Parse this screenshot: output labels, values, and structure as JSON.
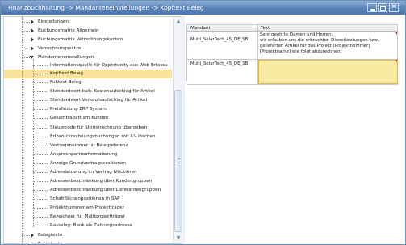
{
  "window": {
    "title": "Finanzbuchhaltung -> Mandanteneinstellungen -> Kopftext Beleg",
    "buttons": {
      "minimize": "minimize-icon",
      "maximize": "maximize-icon",
      "close": "close-icon"
    },
    "close_glyph": "✕"
  },
  "tree": {
    "items": [
      {
        "label": "Einstellungen",
        "expander": "right"
      },
      {
        "label": "Buchungsmatrix Allgemein",
        "expander": "right"
      },
      {
        "label": "Buchungsmatrix Verrechnungskonten",
        "expander": "right"
      },
      {
        "label": "Verrechnungssätze",
        "expander": "right"
      },
      {
        "label": "Mandanteneinstellungen",
        "expander": "down"
      },
      {
        "label": "Informationsquelle für Opportunity aus Web-Erfassu",
        "expander": "none"
      },
      {
        "label": "Kopftext Beleg",
        "expander": "none",
        "selected": true
      },
      {
        "label": "Fußtext Beleg",
        "expander": "none"
      },
      {
        "label": "Standardwert kalk. Kostenaufschlag für Artikel",
        "expander": "none"
      },
      {
        "label": "Standardwert Verkaufsaufschlag für Artikel",
        "expander": "none"
      },
      {
        "label": "Preisfindung ERP System",
        "expander": "none"
      },
      {
        "label": "Gesamtrabatt am Kunden",
        "expander": "none"
      },
      {
        "label": "Steuercode für Stornorechnung übergeben",
        "expander": "none"
      },
      {
        "label": "Erlösrückrechnungsbuchungen mit ILV löschen",
        "expander": "none"
      },
      {
        "label": "Vertragsnummer ist Belegreferenz",
        "expander": "none"
      },
      {
        "label": "Ansprechpartnerformatierung",
        "expander": "none"
      },
      {
        "label": "Anzeige Grundvertragspositionen",
        "expander": "none"
      },
      {
        "label": "Adressänderung im Vertrag blockieren",
        "expander": "none"
      },
      {
        "label": "Adressenbeschränkung über Kundengruppen",
        "expander": "none"
      },
      {
        "label": "Adressenbeschränkung über Lieferantengruppen",
        "expander": "none"
      },
      {
        "label": "Schaltflächenpositionen in SAP",
        "expander": "none"
      },
      {
        "label": "Projektnummer am Projektträger",
        "expander": "none"
      },
      {
        "label": "Bezeichner für Multiprojektträger",
        "expander": "none"
      },
      {
        "label": "Rasseleg: Bank als Zahlungsadresse",
        "expander": "none"
      },
      {
        "label": "Belegtexte",
        "expander": "right"
      },
      {
        "label": "Belegtexte",
        "expander": "right"
      }
    ]
  },
  "scrollbar": {
    "up_glyph": "▲",
    "down_glyph": "▼"
  },
  "grid": {
    "columns": [
      "Mandant",
      "Text"
    ],
    "rows": [
      {
        "mandant": "Multi_SolarTech_45_DE_SB",
        "text": [
          "Sehr geehrte Damen und Herren,",
          "wir erlauben uns die erbrachten Dienstleistungen bzw.",
          "gelieferten Artikel für das Projekt [Projektnummer]",
          "[Projektname] wie folgt abzurechnen:"
        ]
      },
      {
        "mandant": "Multi_SolarTech_45_DE_SB",
        "text": []
      }
    ]
  },
  "colors": {
    "title_bar": "#5a83b8",
    "selection": "#fbe29a",
    "edit_cell": "#faeba3",
    "required_marker": "#e03020"
  }
}
